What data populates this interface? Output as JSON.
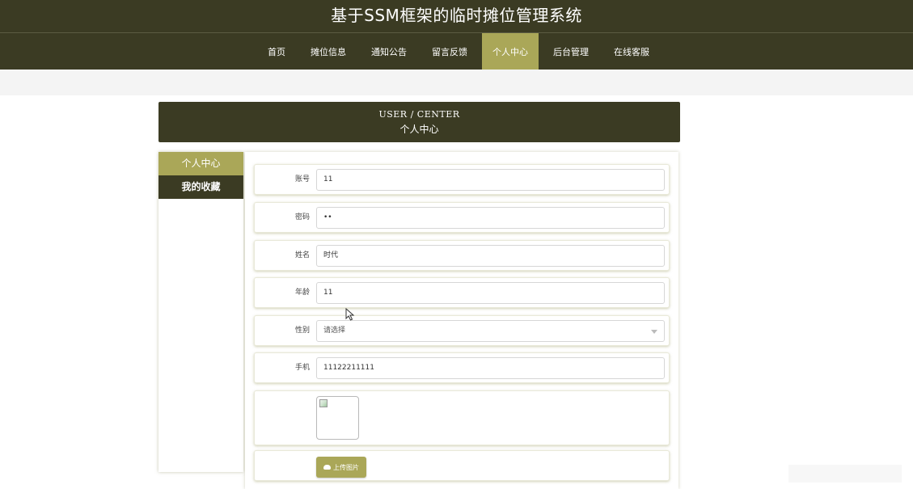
{
  "header": {
    "title": "基于SSM框架的临时摊位管理系统"
  },
  "nav": {
    "items": [
      {
        "label": "首页",
        "active": false
      },
      {
        "label": "摊位信息",
        "active": false
      },
      {
        "label": "通知公告",
        "active": false
      },
      {
        "label": "留言反馈",
        "active": false
      },
      {
        "label": "个人中心",
        "active": true
      },
      {
        "label": "后台管理",
        "active": false
      },
      {
        "label": "在线客服",
        "active": false
      }
    ]
  },
  "banner": {
    "english": "USER / CENTER",
    "chinese": "个人中心"
  },
  "sidebar": {
    "items": [
      {
        "label": "个人中心",
        "active": true
      },
      {
        "label": "我的收藏",
        "active": false
      }
    ]
  },
  "form": {
    "account": {
      "label": "账号",
      "value": "11"
    },
    "password": {
      "label": "密码",
      "value": "••"
    },
    "name": {
      "label": "姓名",
      "value": "时代"
    },
    "age": {
      "label": "年龄",
      "value": "11"
    },
    "gender": {
      "label": "性别",
      "value": "请选择"
    },
    "phone": {
      "label": "手机",
      "value": "11122211111"
    },
    "upload_label": "上传图片"
  },
  "colors": {
    "header_bg": "#3b3b23",
    "accent": "#aaa758"
  },
  "icons": {
    "select": "chevron-down-icon",
    "upload": "cloud-upload-icon",
    "image": "broken-image-icon",
    "cursor": "mouse-pointer-icon"
  }
}
